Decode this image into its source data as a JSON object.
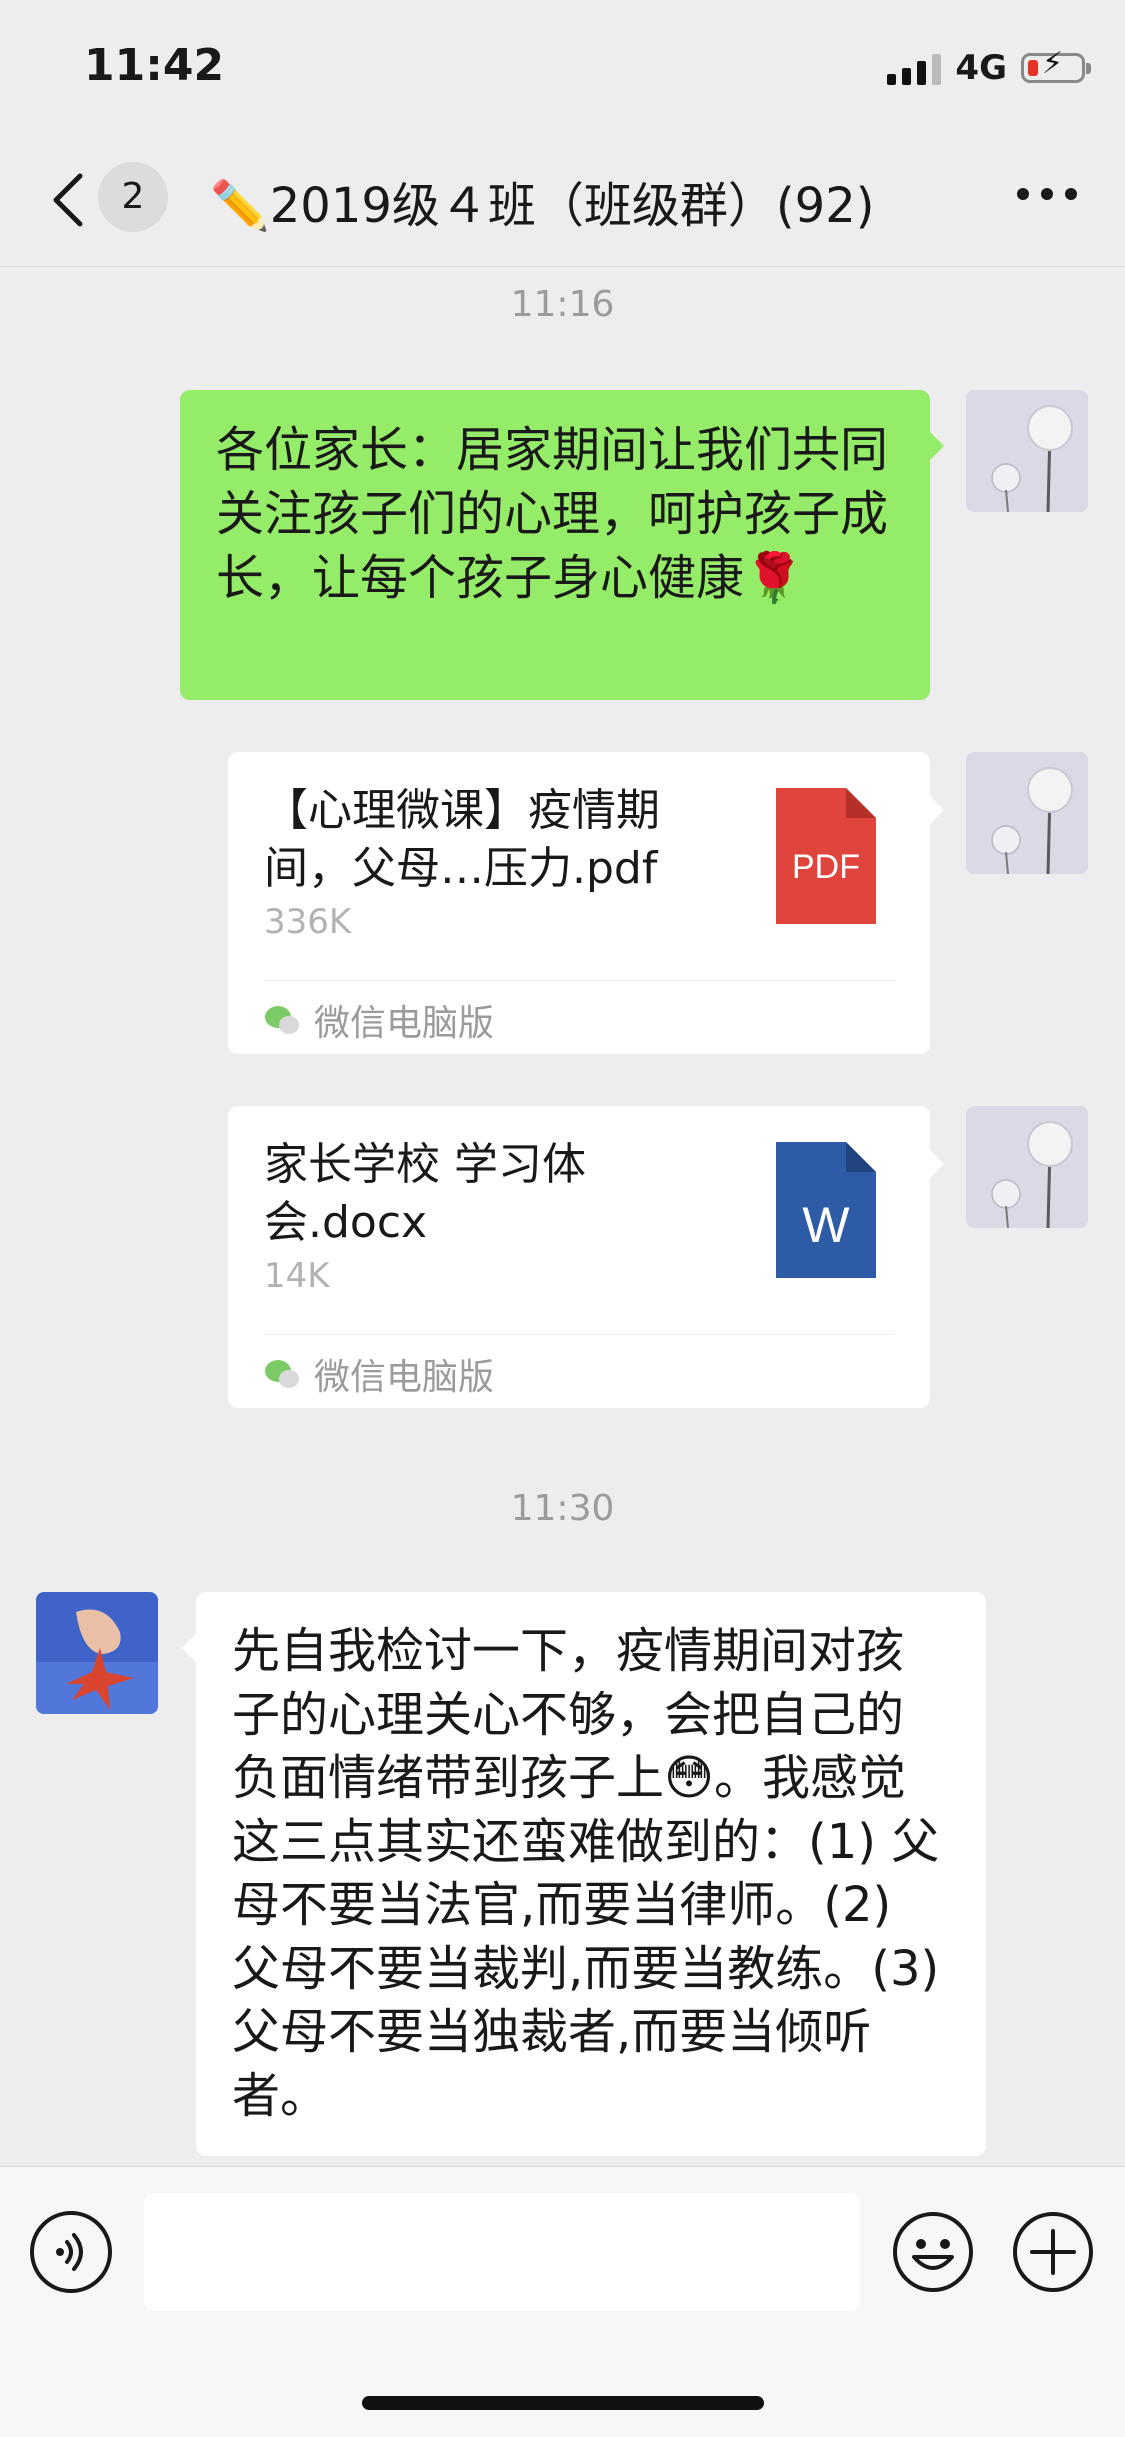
{
  "status_bar": {
    "time": "11:42",
    "network": "4G",
    "battery_low_color": "#E5332A"
  },
  "nav": {
    "unread_count": "2",
    "title": "✏️2019级４班（班级群）(92)"
  },
  "messages": {
    "time_1": "11:16",
    "text_1": "各位家长：居家期间让我们共同关注孩子们的心理，呵护孩子成长，让每个孩子身心健康🌹",
    "file_1": {
      "name": "【心理微课】疫情期间，父母…压力.pdf",
      "size": "336K",
      "source": "微信电脑版",
      "icon_label": "PDF",
      "icon_color": "#E0453D"
    },
    "file_2": {
      "name": "家长学校 学习体会.docx",
      "size": "14K",
      "source": "微信电脑版",
      "icon_label": "W",
      "icon_color": "#2D5BA6"
    },
    "time_2": "11:30",
    "text_2": "先自我检讨一下，疫情期间对孩子的心理关心不够，会把自己的负面情绪带到孩子上😳。我感觉这三点其实还蛮难做到的：(1) 父母不要当法官,而要当律师。(2) 父母不要当裁判,而要当教练。(3) 父母不要当独裁者,而要当倾听者。"
  },
  "colors": {
    "sent_bubble": "#95EC69",
    "received_bubble": "#FFFFFF",
    "background": "#EDEDED"
  },
  "icons": [
    "back-chevron-icon",
    "more-icon",
    "voice-icon",
    "emoji-icon",
    "plus-icon",
    "wechat-icon",
    "pdf-file-icon",
    "word-file-icon"
  ]
}
